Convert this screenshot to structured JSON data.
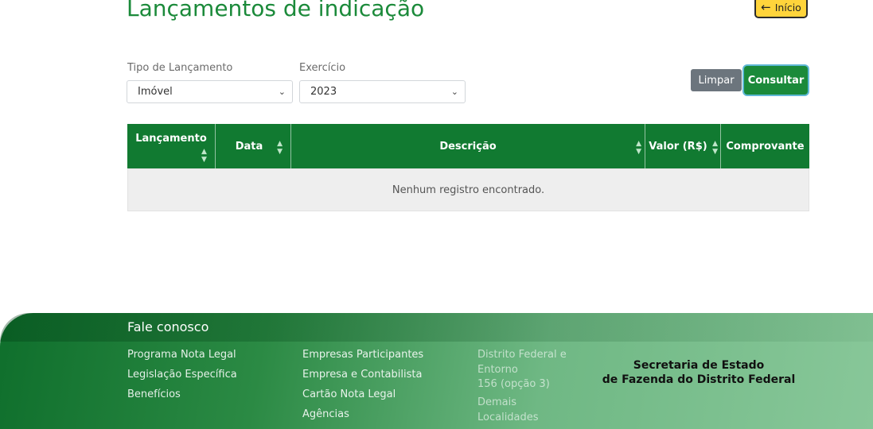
{
  "header": {
    "title": "Lançamentos de indicação",
    "home_label": "Início"
  },
  "filters": {
    "tipo_label": "Tipo de Lançamento",
    "tipo_value": "Imóvel",
    "exercicio_label": "Exercício",
    "exercicio_value": "2023",
    "limpar_label": "Limpar",
    "consultar_label": "Consultar"
  },
  "table": {
    "columns": [
      "Lançamento",
      "Data",
      "Descrição",
      "Valor (R$)",
      "Comprovante"
    ],
    "empty_message": "Nenhum registro encontrado."
  },
  "footer": {
    "title": "Fale conosco",
    "col1": [
      "Programa Nota Legal",
      "Legislação Específica",
      "Benefícios"
    ],
    "col2": [
      "Empresas Participantes",
      "Empresa e Contabilista",
      "Cartão Nota Legal",
      "Agências"
    ],
    "col3": [
      "Distrito Federal e",
      "Entorno",
      "156 (opção 3)",
      "Demais",
      "Localidades"
    ],
    "secretaria_line1": "Secretaria de Estado",
    "secretaria_line2": "de Fazenda do Distrito Federal"
  },
  "colors": {
    "primary_green": "#1b8a3a",
    "header_green": "#117a31",
    "home_yellow": "#ffd43b",
    "limpar_gray": "#6c757d"
  }
}
